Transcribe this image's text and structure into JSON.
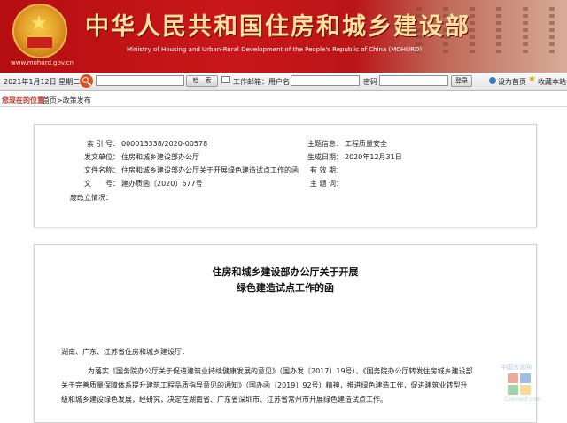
{
  "banner": {
    "title_cn": "中华人民共和国住房和城乡建设部",
    "title_en": "Ministry of Housing and Urban-Rural Development of the People's Republic of China (MOHURD)",
    "site_url": "www.mohurd.gov.cn"
  },
  "toolbar": {
    "date": "2021年1月12日 星期二",
    "search_button": "检　索",
    "mail_label": "工作邮箱：用户名",
    "password_label": "密码",
    "login_button": "登录",
    "homepage_link": "设为首页",
    "favorite_link": "收藏本站"
  },
  "breadcrumb": {
    "location_label": "您现在的位置：",
    "path": "首页>政策发布"
  },
  "info": {
    "index_label": "索 引 号：",
    "index_value": "000013338/2020-00578",
    "topic_label": "主题信息：",
    "topic_value": "工程质量安全",
    "issuer_label": "发文单位：",
    "issuer_value": "住房和城乡建设部办公厅",
    "date_label": "生成日期：",
    "date_value": "2020年12月31日",
    "doctitle_label": "文件名称：",
    "doctitle_value": "住房和城乡建设部办公厅关于开展绿色建造试点工作的函",
    "validity_label": "有 效 期：",
    "validity_value": "",
    "docnum_label": "文　　号：",
    "docnum_value": "建办质函〔2020〕677号",
    "keywords_label": "主 题 词：",
    "keywords_value": "",
    "abolish_label": "废改立情况：",
    "abolish_value": ""
  },
  "document": {
    "title_line1": "住房和城乡建设部办公厅关于开展",
    "title_line2": "绿色建造试点工作的函",
    "addressee": "湖南、广东、江苏省住房和城乡建设厅：",
    "para_line1": "为落实《国务院办公厅关于促进建筑业持续健康发展的意见》（国办发〔2017〕19号）、《国务院办公厅转发住房城乡建设部",
    "para_line2": "关于完善质量保障体系提升建筑工程品质指导意见的通知》（国办函〔2019〕92号）精神，推进绿色建造工作，促进建筑业转型升",
    "para_line3": "级和城乡建设绿色发展，经研究，决定在湖南省、广东省深圳市、江苏省常州市开展绿色建造试点工作。"
  },
  "watermark": {
    "text": "中国水泥网",
    "url": "Ccement.com"
  }
}
